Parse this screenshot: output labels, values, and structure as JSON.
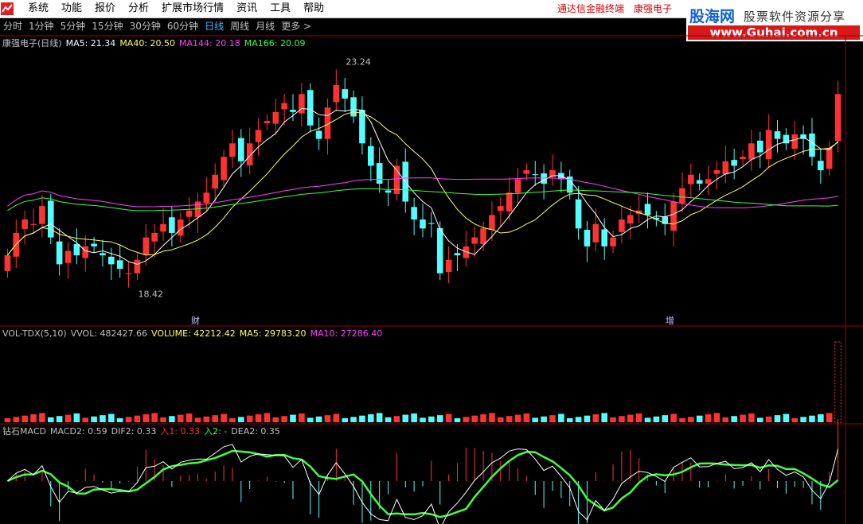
{
  "menubar": {
    "items": [
      "系统",
      "功能",
      "报价",
      "分析",
      "扩展市场行情",
      "资讯",
      "工具",
      "帮助"
    ],
    "right": [
      "通达信金融终端",
      "康强电子"
    ]
  },
  "brand": {
    "name": "股海网",
    "slogan": "股票软件资源分享",
    "url": "www.Guhai.com.cn"
  },
  "period_tabs": [
    {
      "label": "分时",
      "active": false
    },
    {
      "label": "1分钟",
      "active": false
    },
    {
      "label": "5分钟",
      "active": false
    },
    {
      "label": "15分钟",
      "active": false
    },
    {
      "label": "30分钟",
      "active": false
    },
    {
      "label": "60分钟",
      "active": false
    },
    {
      "label": "日线",
      "active": true
    },
    {
      "label": "周线",
      "active": false
    },
    {
      "label": "月线",
      "active": false
    },
    {
      "label": "更多 >",
      "active": false
    }
  ],
  "main_legend": [
    {
      "text": "康强电子(日线)",
      "color": "#c0c0c0"
    },
    {
      "text": "MA5: 21.34",
      "color": "#ffffff"
    },
    {
      "text": "MA40: 20.50",
      "color": "#ffff60"
    },
    {
      "text": "MA144: 20.18",
      "color": "#ff40ff"
    },
    {
      "text": "MA166: 20.09",
      "color": "#40ff40"
    }
  ],
  "annotations": {
    "high": "23.24",
    "low": "18.42",
    "tag_cai": "财",
    "tag_zeng": "增"
  },
  "vol_legend": [
    {
      "text": "VOL-TDX(5,10)",
      "color": "#c0c0c0"
    },
    {
      "text": "VVOL: 482427.66",
      "color": "#c0c0c0"
    },
    {
      "text": "VOLUME: 42212.42",
      "color": "#ffff60"
    },
    {
      "text": "MA5: 29783.20",
      "color": "#ffff60"
    },
    {
      "text": "MA10: 27286.40",
      "color": "#ff40ff"
    }
  ],
  "macd_legend": [
    {
      "text": "钻石MACD",
      "color": "#c0c0c0"
    },
    {
      "text": "MACD2: 0.59",
      "color": "#c0c0c0"
    },
    {
      "text": "DIF2: 0.33",
      "color": "#c0c0c0"
    },
    {
      "text": "入1: 0.33",
      "color": "#ff3030"
    },
    {
      "text": "入2: -",
      "color": "#40ff40"
    },
    {
      "text": "DEA2: 0.35",
      "color": "#c0c0c0"
    }
  ],
  "chart_data": {
    "type": "candlestick",
    "price_range": [
      18.0,
      24.0
    ],
    "colors": {
      "up": "#ff3232",
      "down": "#54fcfc",
      "ma5": "#ffffff",
      "ma40": "#ffff60",
      "ma144": "#ff40ff",
      "ma166": "#40ff40"
    },
    "closes": [
      19.4,
      19.9,
      20.2,
      20.1,
      20.5,
      19.8,
      19.2,
      19.5,
      19.4,
      19.6,
      19.6,
      19.4,
      19.2,
      19.1,
      19.0,
      19.3,
      19.8,
      19.9,
      20.1,
      19.9,
      20.2,
      20.4,
      20.6,
      20.8,
      21.2,
      21.6,
      21.9,
      21.5,
      21.9,
      22.2,
      22.4,
      22.6,
      22.8,
      22.6,
      23.0,
      22.3,
      22.0,
      22.7,
      23.2,
      22.9,
      22.5,
      21.9,
      21.4,
      21.0,
      20.8,
      21.4,
      20.6,
      20.2,
      20.0,
      20.1,
      19.0,
      19.3,
      19.4,
      19.6,
      19.8,
      20.0,
      20.3,
      20.5,
      20.8,
      21.1,
      21.3,
      21.2,
      21.0,
      21.3,
      21.1,
      20.8,
      20.0,
      19.6,
      20.1,
      19.6,
      19.8,
      20.2,
      20.3,
      20.4,
      20.3,
      20.2,
      20.1,
      20.6,
      20.9,
      21.2,
      21.0,
      21.1,
      21.3,
      21.5,
      21.4,
      21.6,
      21.9,
      21.7,
      22.2,
      22.0,
      21.9,
      22.1,
      22.0,
      21.6,
      21.3,
      21.8,
      23.0
    ],
    "volume_max": 482427.66,
    "macd_dif_last": 0.33,
    "macd_dea_last": 0.35,
    "macd_last": 0.59
  }
}
